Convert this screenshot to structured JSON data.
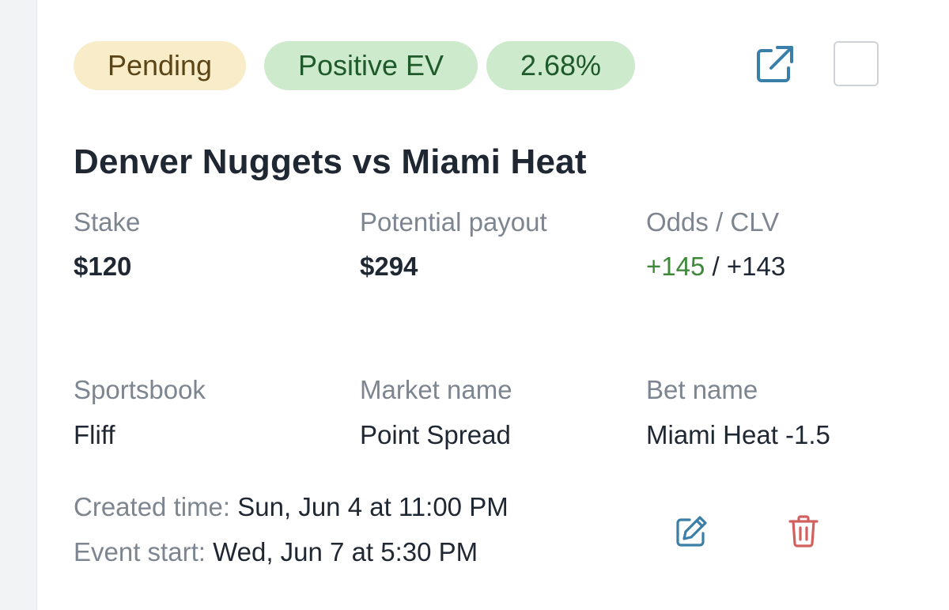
{
  "badges": {
    "status": "Pending",
    "ev": "Positive EV",
    "ev_percent": "2.68%"
  },
  "event_title": "Denver Nuggets vs Miami Heat",
  "stats": {
    "stake_label": "Stake",
    "stake_value": "$120",
    "payout_label": "Potential payout",
    "payout_value": "$294",
    "odds_label": "Odds / CLV",
    "odds_value": "+145",
    "odds_separator": "/",
    "clv_value": "+143"
  },
  "details": {
    "sportsbook_label": "Sportsbook",
    "sportsbook_value": "Fliff",
    "market_label": "Market name",
    "market_value": "Point Spread",
    "bet_label": "Bet name",
    "bet_value": "Miami Heat -1.5"
  },
  "meta": {
    "created_label": "Created time:",
    "created_value": "Sun, Jun 4 at 11:00 PM",
    "event_start_label": "Event start:",
    "event_start_value": "Wed, Jun 7 at 5:30 PM"
  },
  "colors": {
    "pending_bg": "#f8edc8",
    "ev_bg": "#cdeacd",
    "odds_positive": "#3e8a3a",
    "icon_blue": "#3a7fa8",
    "delete_red": "#d2605e"
  },
  "icons": {
    "open": "external-link-icon",
    "edit": "edit-icon",
    "delete": "trash-icon"
  }
}
